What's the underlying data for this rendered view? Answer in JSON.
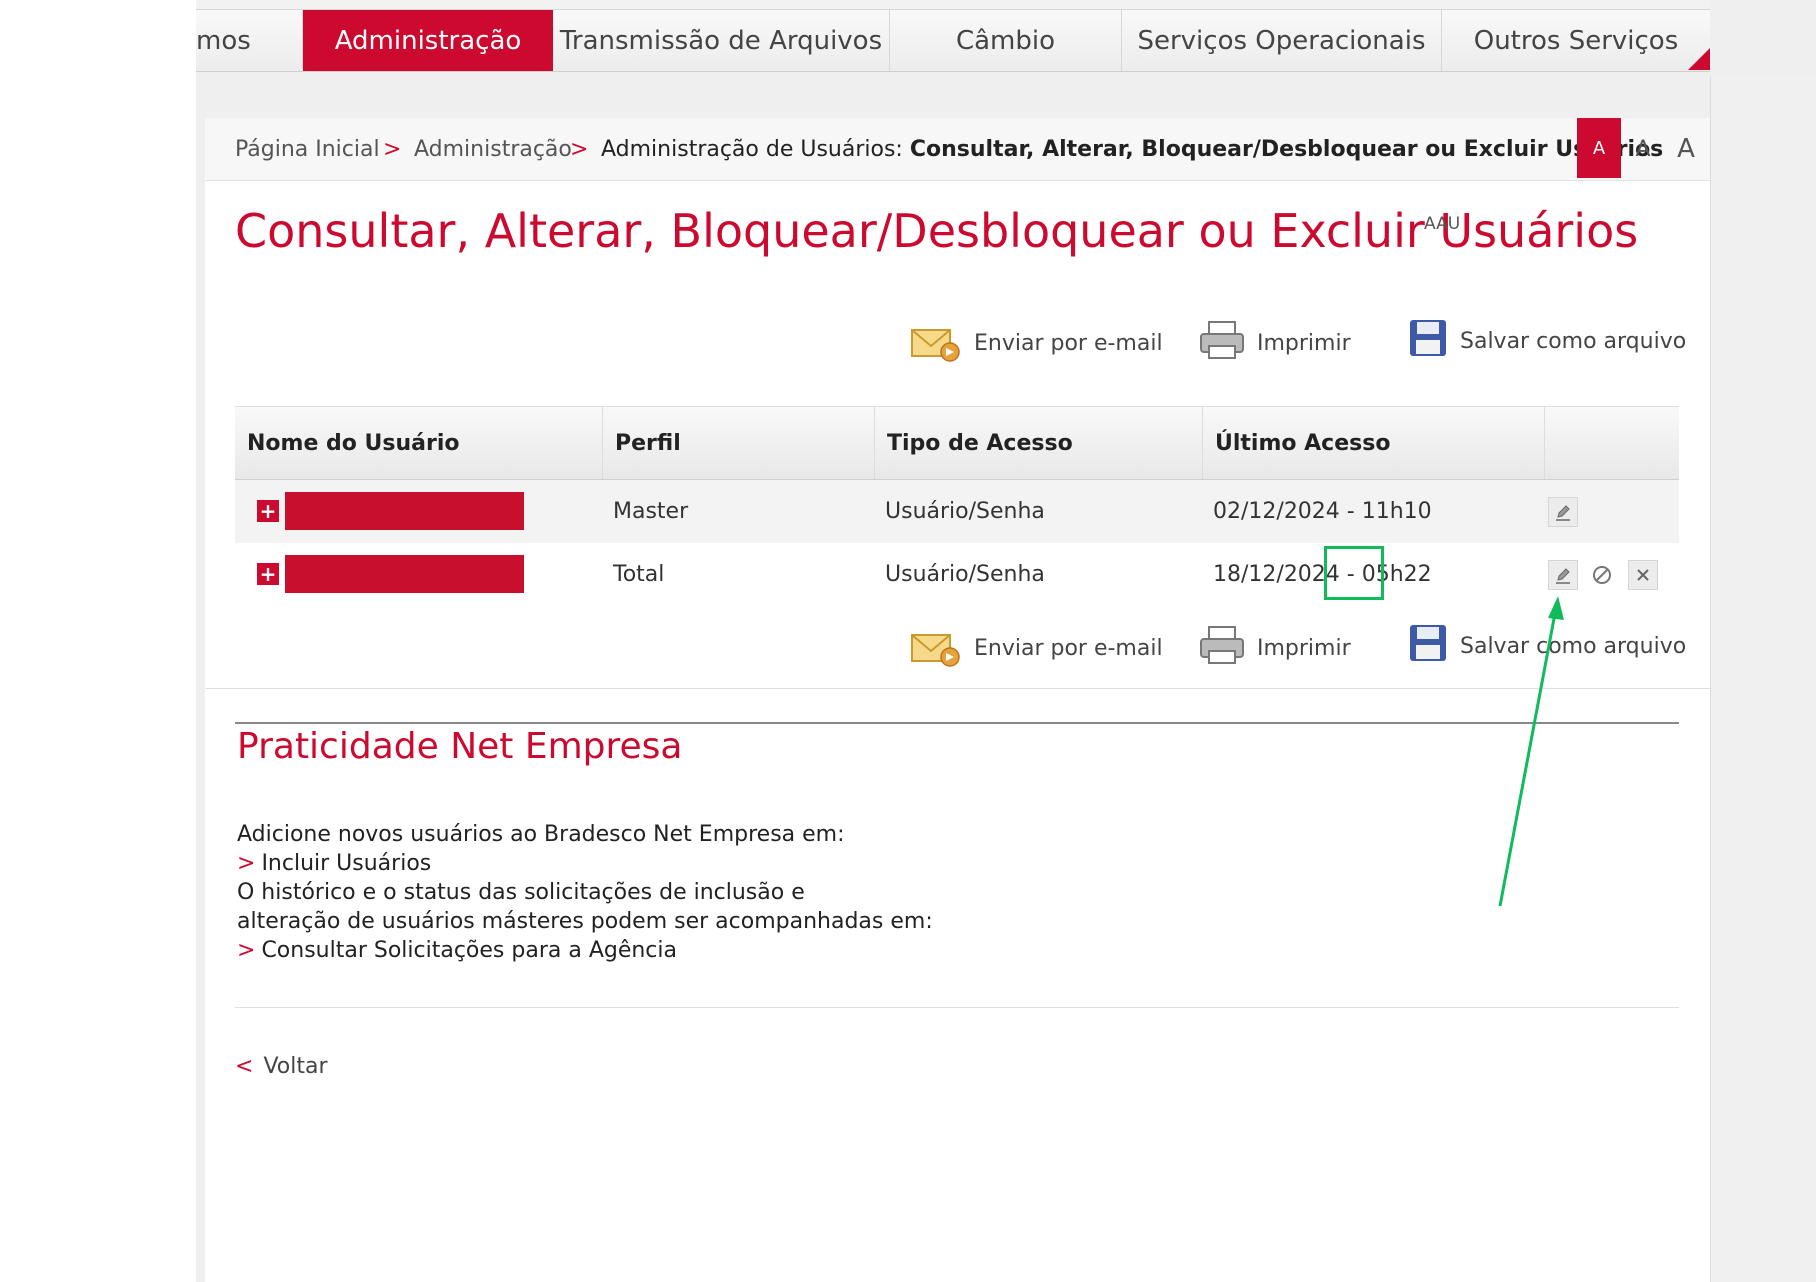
{
  "nav": {
    "items": [
      {
        "label": "mos"
      },
      {
        "label": "Administração",
        "active": true
      },
      {
        "label": "Transmissão de Arquivos"
      },
      {
        "label": "Câmbio"
      },
      {
        "label": "Serviços Operacionais"
      },
      {
        "label": "Outros Serviços"
      }
    ]
  },
  "breadcrumb": {
    "home": "Página Inicial",
    "section": "Administração",
    "current_prefix": "Administração de Usuários:",
    "current_bold": "Consultar, Alterar, Bloquear/Desbloquear ou Excluir Usuários"
  },
  "font_controls": [
    "A",
    "A",
    "A"
  ],
  "page": {
    "title": "Consultar, Alterar, Bloquear/Desbloquear ou Excluir Usuários",
    "code": "AAU"
  },
  "actions": {
    "email": "Enviar por e-mail",
    "print": "Imprimir",
    "save": "Salvar como arquivo"
  },
  "table": {
    "headers": [
      "Nome do Usuário",
      "Perfil",
      "Tipo de Acesso",
      "Último Acesso"
    ],
    "rows": [
      {
        "profile": "Master",
        "access_type": "Usuário/Senha",
        "last_access": "02/12/2024 - 11h10"
      },
      {
        "profile": "Total",
        "access_type": "Usuário/Senha",
        "last_access": "18/12/2024 - 05h22"
      }
    ]
  },
  "info": {
    "title": "Praticidade Net Empresa",
    "line1": "Adicione novos usuários ao Bradesco Net Empresa em:",
    "link1": "Incluir Usuários",
    "line2": "O histórico e o status das solicitações de inclusão e",
    "line3": "alteração de usuários másteres podem ser acompanhadas em:",
    "link2": "Consultar Solicitações para a Agência"
  },
  "back": "Voltar",
  "colors": {
    "brand": "#cc092f",
    "highlight": "#10bb5a"
  }
}
